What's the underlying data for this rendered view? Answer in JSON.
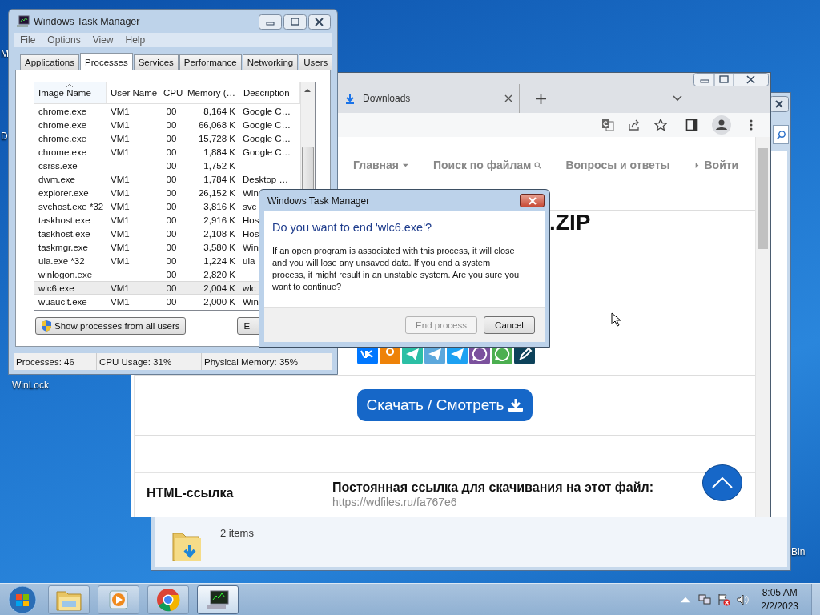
{
  "desktop": {
    "icon_labels": [
      "M",
      "D",
      "WinLock",
      "Bin"
    ]
  },
  "explorer": {
    "status": "2 items"
  },
  "browser": {
    "tab": {
      "title": "Downloads"
    },
    "nav": [
      {
        "label": "Главная",
        "kind": "dropdown"
      },
      {
        "label": "Поиск по файлам",
        "kind": "search"
      },
      {
        "label": "Вопросы и ответы",
        "kind": "plain"
      },
      {
        "label": "Войти",
        "kind": "login"
      }
    ],
    "title": ".ZIP",
    "share_icons": [
      {
        "kind": "vk",
        "color": "#0077ff"
      },
      {
        "kind": "ok",
        "color": "#ee8208"
      },
      {
        "kind": "arrow",
        "color": "#2bbfa5"
      },
      {
        "kind": "telegram",
        "color": "#5ca8dc"
      },
      {
        "kind": "bird",
        "color": "#1da1f2"
      },
      {
        "kind": "phone",
        "color": "#7b519d"
      },
      {
        "kind": "chat",
        "color": "#4caf50"
      },
      {
        "kind": "pen",
        "color": "#0d425a"
      }
    ],
    "download_button": "Скачать / Смотреть",
    "link_row": {
      "label": "HTML-ссылка",
      "heading": "Постоянная ссылка для скачивания на этот файл:",
      "url": "https://wdfiles.ru/fa767e6"
    }
  },
  "task_manager": {
    "title": "Windows Task Manager",
    "menu": [
      "File",
      "Options",
      "View",
      "Help"
    ],
    "tabs": [
      {
        "label": "Applications",
        "selected": false
      },
      {
        "label": "Processes",
        "selected": true
      },
      {
        "label": "Services",
        "selected": false
      },
      {
        "label": "Performance",
        "selected": false
      },
      {
        "label": "Networking",
        "selected": false
      },
      {
        "label": "Users",
        "selected": false
      }
    ],
    "columns": [
      {
        "label": "Image Name",
        "sorted": true
      },
      {
        "label": "User Name",
        "sorted": false
      },
      {
        "label": "CPU",
        "sorted": false
      },
      {
        "label": "Memory (…",
        "sorted": false
      },
      {
        "label": "Description",
        "sorted": false
      }
    ],
    "rows": [
      {
        "image": "chrome.exe",
        "user": "VM1",
        "cpu": "00",
        "memory": "8,164 K",
        "description": "Google C…",
        "selected": false
      },
      {
        "image": "chrome.exe",
        "user": "VM1",
        "cpu": "00",
        "memory": "66,068 K",
        "description": "Google C…",
        "selected": false
      },
      {
        "image": "chrome.exe",
        "user": "VM1",
        "cpu": "00",
        "memory": "15,728 K",
        "description": "Google C…",
        "selected": false
      },
      {
        "image": "chrome.exe",
        "user": "VM1",
        "cpu": "00",
        "memory": "1,884 K",
        "description": "Google C…",
        "selected": false
      },
      {
        "image": "csrss.exe",
        "cpu": "00",
        "memory": "1,752 K",
        "selected": false
      },
      {
        "image": "dwm.exe",
        "user": "VM1",
        "cpu": "00",
        "memory": "1,784 K",
        "description": "Desktop …",
        "selected": false
      },
      {
        "image": "explorer.exe",
        "user": "VM1",
        "cpu": "00",
        "memory": "26,152 K",
        "description": "Win",
        "selected": false
      },
      {
        "image": "svchost.exe *32",
        "user": "VM1",
        "cpu": "00",
        "memory": "3,816 K",
        "description": "svc",
        "selected": false
      },
      {
        "image": "taskhost.exe",
        "user": "VM1",
        "cpu": "00",
        "memory": "2,916 K",
        "description": "Hos",
        "selected": false
      },
      {
        "image": "taskhost.exe",
        "user": "VM1",
        "cpu": "00",
        "memory": "2,108 K",
        "description": "Hos",
        "selected": false
      },
      {
        "image": "taskmgr.exe",
        "user": "VM1",
        "cpu": "00",
        "memory": "3,580 K",
        "description": "Win",
        "selected": false
      },
      {
        "image": "uia.exe *32",
        "user": "VM1",
        "cpu": "00",
        "memory": "1,224 K",
        "description": "uia",
        "selected": false
      },
      {
        "image": "winlogon.exe",
        "cpu": "00",
        "memory": "2,820 K",
        "selected": false
      },
      {
        "image": "wlc6.exe",
        "user": "VM1",
        "cpu": "00",
        "memory": "2,004 K",
        "description": "wlc",
        "selected": true
      },
      {
        "image": "wuauclt.exe",
        "user": "VM1",
        "cpu": "00",
        "memory": "2,000 K",
        "description": "Win",
        "selected": false
      }
    ],
    "show_all_button": "Show processes from all users",
    "end_button": "E",
    "status": [
      "Processes: 46",
      "CPU Usage: 31%",
      "Physical Memory: 35%"
    ]
  },
  "dialog": {
    "title": "Windows Task Manager",
    "heading": "Do you want to end 'wlc6.exe'?",
    "body": "If an open program is associated with this process, it will close and you will lose any unsaved data. If you end a system process, it might result in an unstable system. Are you sure you want to continue?",
    "buttons": [
      {
        "label": "End process",
        "disabled": true
      },
      {
        "label": "Cancel",
        "disabled": false
      }
    ]
  },
  "taskbar": {
    "apps": [
      {
        "kind": "folder",
        "selected": false
      },
      {
        "kind": "media",
        "selected": false
      },
      {
        "kind": "browser",
        "selected": false
      },
      {
        "kind": "monitor",
        "selected": true
      }
    ],
    "time": "8:05 AM",
    "date": "2/2/2023"
  }
}
